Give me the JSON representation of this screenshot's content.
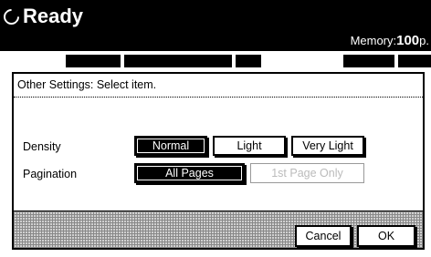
{
  "header": {
    "status": "Ready",
    "memory_label": "Memory:",
    "memory_value": "100",
    "memory_unit": "p."
  },
  "dialog": {
    "heading": "Other Settings: Select item.",
    "density": {
      "label": "Density",
      "options": [
        "Normal",
        "Light",
        "Very Light"
      ],
      "selected": "Normal"
    },
    "pagination": {
      "label": "Pagination",
      "options": [
        "All Pages",
        "1st Page Only"
      ],
      "selected": "All Pages"
    },
    "cancel_label": "Cancel",
    "ok_label": "OK"
  },
  "colors": {
    "header_bg": "#000000",
    "selected_bg": "#000000",
    "disabled_text": "#bbbbbb"
  }
}
